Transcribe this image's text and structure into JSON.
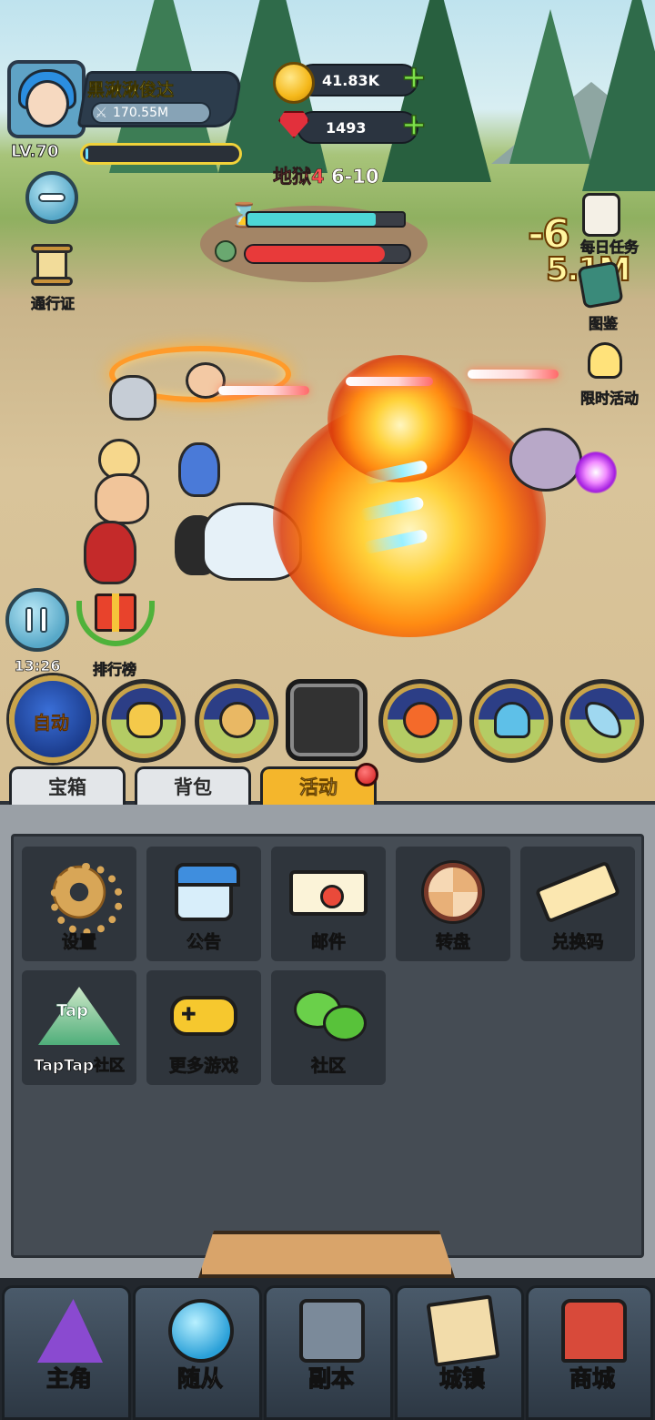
{
  "player": {
    "name": "黑湫湫俊达",
    "power": "170.55M",
    "level": "LV.70",
    "xp_fraction": 0.02
  },
  "resources": {
    "gold": "41.83K",
    "gems": "1493"
  },
  "stage": {
    "zone": "地狱4",
    "level": "6-10",
    "timer_fraction": 0.82,
    "boss_hp_fraction": 0.85
  },
  "left_hud": {
    "battle_pass_label": "通行证",
    "time": "13:26",
    "leaderboard_label": "排行榜"
  },
  "right_hud": {
    "daily_tasks_label": "每日任务",
    "codex_label": "图鉴",
    "limited_event_label": "限时活动",
    "damage_text_1": "-6",
    "damage_text_2": "5.1M"
  },
  "skills": {
    "auto_label": "自动"
  },
  "tabs": [
    {
      "label": "宝箱"
    },
    {
      "label": "背包"
    },
    {
      "label": "活动"
    }
  ],
  "menu": [
    {
      "label": "设置",
      "icon": "gear-icon"
    },
    {
      "label": "公告",
      "icon": "calendar-icon"
    },
    {
      "label": "邮件",
      "icon": "mail-icon"
    },
    {
      "label": "转盘",
      "icon": "wheel-icon"
    },
    {
      "label": "兑换码",
      "icon": "ticket-icon"
    },
    {
      "label": "TapTap社区",
      "icon": "taptap-icon"
    },
    {
      "label": "更多游戏",
      "icon": "gamepad-icon"
    },
    {
      "label": "社区",
      "icon": "chat-icon"
    }
  ],
  "taptap_icon_text": "Tap",
  "bottom_nav": [
    {
      "label": "主角",
      "icon": "wizard-hat-icon"
    },
    {
      "label": "随从",
      "icon": "pet-orb-icon"
    },
    {
      "label": "副本",
      "icon": "dungeon-tower-icon"
    },
    {
      "label": "城镇",
      "icon": "town-map-icon"
    },
    {
      "label": "商城",
      "icon": "shop-icon"
    }
  ],
  "colors": {
    "active_tab": "#f4b62c",
    "hell_text": "#ff5050",
    "boss_hp": "#e83a3a",
    "timer": "#4dd6d6",
    "panel_bg": "#454c54"
  }
}
